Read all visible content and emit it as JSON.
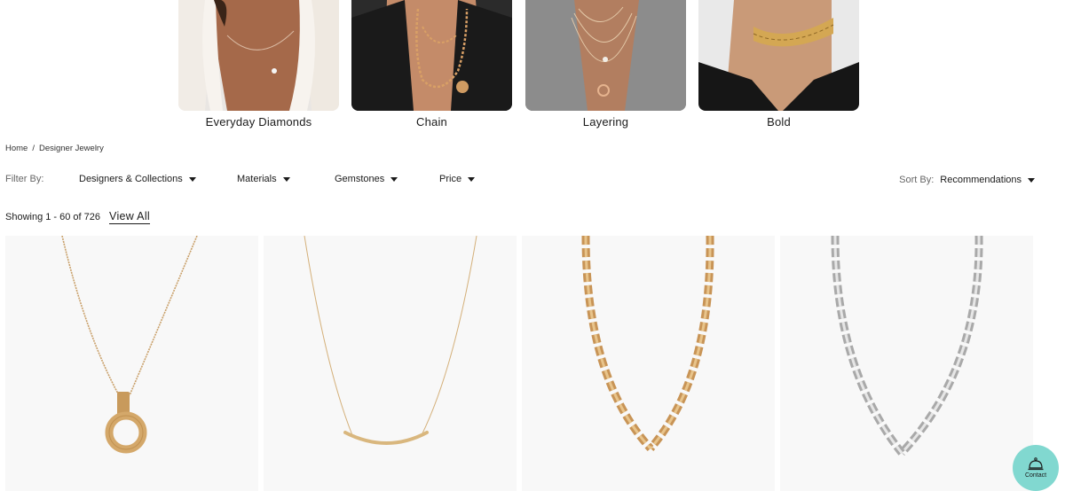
{
  "categories": [
    {
      "label": "Everyday Diamonds",
      "image": "model-wearing-diamond-pendant"
    },
    {
      "label": "Chain",
      "image": "model-wearing-chain-necklaces"
    },
    {
      "label": "Layering",
      "image": "model-wearing-layered-necklaces"
    },
    {
      "label": "Bold",
      "image": "model-wearing-bold-choker"
    }
  ],
  "breadcrumb": {
    "home": "Home",
    "separator": "/",
    "current": "Designer Jewelry"
  },
  "filters": {
    "label": "Filter By:",
    "items": [
      "Designers & Collections",
      "Materials",
      "Gemstones",
      "Price"
    ],
    "icon": "caret-down-icon"
  },
  "sort": {
    "label": "Sort By:",
    "value": "Recommendations"
  },
  "results": {
    "count_text": "Showing 1 - 60 of 726",
    "view_all": "View All"
  },
  "products": [
    {
      "image": "gold-t-circle-pendant"
    },
    {
      "image": "gold-smile-pendant"
    },
    {
      "image": "gold-link-chain-necklace"
    },
    {
      "image": "silver-link-chain-necklace"
    }
  ],
  "contact": {
    "label": "Contact",
    "icon": "concierge-bell-icon",
    "color": "#81d8d0"
  }
}
